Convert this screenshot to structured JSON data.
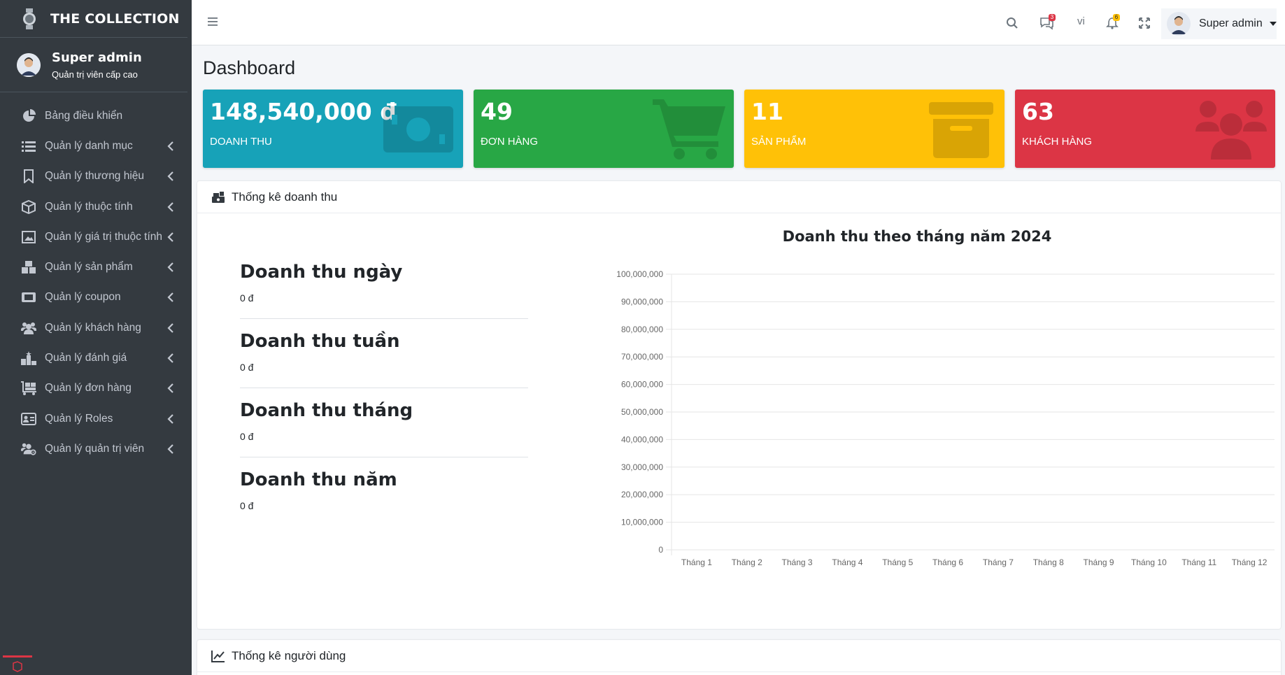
{
  "sidebar": {
    "brand": "THE COLLECTION",
    "user_name": "Super admin",
    "user_role": "Quản trị viên cấp cao",
    "items": [
      {
        "label": "Bảng điều khiển",
        "icon": "pie-chart-icon",
        "chevron": false
      },
      {
        "label": "Quản lý danh mục",
        "icon": "list-icon",
        "chevron": true
      },
      {
        "label": "Quản lý thương hiệu",
        "icon": "bookmark-icon",
        "chevron": true
      },
      {
        "label": "Quản lý thuộc tính",
        "icon": "cube-icon",
        "chevron": true
      },
      {
        "label": "Quản lý giá trị thuộc tính",
        "icon": "photo-icon",
        "chevron": true
      },
      {
        "label": "Quản lý sản phẩm",
        "icon": "boxes-icon",
        "chevron": true
      },
      {
        "label": "Quản lý coupon",
        "icon": "ticket-icon",
        "chevron": true
      },
      {
        "label": "Quản lý khách hàng",
        "icon": "users-icon",
        "chevron": true
      },
      {
        "label": "Quản lý đánh giá",
        "icon": "ranking-icon",
        "chevron": true
      },
      {
        "label": "Quản lý đơn hàng",
        "icon": "dolly-icon",
        "chevron": true
      },
      {
        "label": "Quản lý Roles",
        "icon": "id-card-icon",
        "chevron": true
      },
      {
        "label": "Quản lý quản trị viên",
        "icon": "users-cog-icon",
        "chevron": true
      }
    ]
  },
  "header": {
    "messages_badge": "3",
    "language": "vi",
    "notifications_badge": "6",
    "user_name": "Super admin"
  },
  "page": {
    "title": "Dashboard"
  },
  "stats": [
    {
      "value": "148,540,000 đ",
      "label": "DOANH THU",
      "color": "#17a2b8",
      "icon": "money-bill-icon"
    },
    {
      "value": "49",
      "label": "ĐƠN HÀNG",
      "color": "#28a745",
      "icon": "shopping-cart-icon"
    },
    {
      "value": "11",
      "label": "SẢN PHẨM",
      "color": "#ffc107",
      "icon": "archive-icon"
    },
    {
      "value": "63",
      "label": "KHÁCH HÀNG",
      "color": "#dc3545",
      "icon": "users-icon"
    }
  ],
  "revenue_card": {
    "title": "Thống kê doanh thu",
    "blocks": [
      {
        "heading": "Doanh thu ngày",
        "value": "0 đ"
      },
      {
        "heading": "Doanh thu tuần",
        "value": "0 đ"
      },
      {
        "heading": "Doanh thu tháng",
        "value": "0 đ"
      },
      {
        "heading": "Doanh thu năm",
        "value": "0 đ"
      }
    ]
  },
  "users_card": {
    "title": "Thống kê người dùng"
  },
  "chart_data": {
    "type": "bar",
    "title": "Doanh thu theo tháng năm 2024",
    "categories": [
      "Tháng 1",
      "Tháng 2",
      "Tháng 3",
      "Tháng 4",
      "Tháng 5",
      "Tháng 6",
      "Tháng 7",
      "Tháng 8",
      "Tháng 9",
      "Tháng 10",
      "Tháng 11",
      "Tháng 12"
    ],
    "values": [
      0,
      0,
      0,
      0,
      0,
      0,
      0,
      0,
      0,
      0,
      0,
      0
    ],
    "yticks": [
      "0",
      "10,000,000",
      "20,000,000",
      "30,000,000",
      "40,000,000",
      "50,000,000",
      "60,000,000",
      "70,000,000",
      "80,000,000",
      "90,000,000",
      "100,000,000"
    ],
    "ylim": [
      0,
      100000000
    ],
    "grid": true
  }
}
